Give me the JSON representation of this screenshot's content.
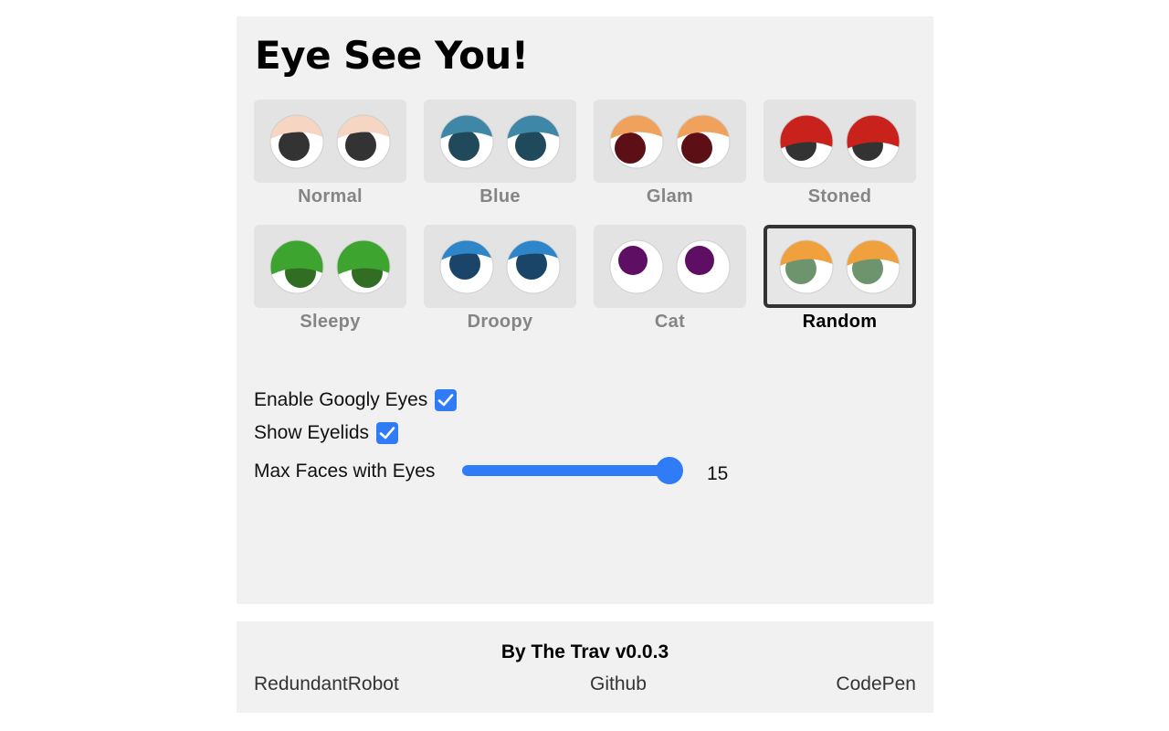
{
  "title": "Eye See You!",
  "styles": [
    {
      "label": "Normal",
      "lid": "#f6d6c2",
      "iris": "#333333",
      "style": "normal"
    },
    {
      "label": "Blue",
      "lid": "#3f87a6",
      "iris": "#21495c",
      "style": "normal"
    },
    {
      "label": "Glam",
      "lid": "#f0a25c",
      "iris": "#5c1015",
      "style": "glam"
    },
    {
      "label": "Stoned",
      "lid": "#c9221d",
      "iris": "#333333",
      "style": "stoned"
    },
    {
      "label": "Sleepy",
      "lid": "#3da52f",
      "iris": "#316e23",
      "style": "sleepy"
    },
    {
      "label": "Droopy",
      "lid": "#2e86c9",
      "iris": "#1b4568",
      "style": "droopy"
    },
    {
      "label": "Cat",
      "lid": "none",
      "iris": "#5e0f63",
      "style": "cat"
    },
    {
      "label": "Random",
      "lid": "#f0a03c",
      "iris": "#6e946e",
      "style": "random",
      "selected": true
    }
  ],
  "settings": {
    "googly_label": "Enable Googly Eyes",
    "googly_checked": true,
    "eyelids_label": "Show Eyelids",
    "eyelids_checked": true,
    "max_faces_label": "Max Faces with Eyes",
    "max_faces_value": "15",
    "max_faces_fraction": 1.0
  },
  "footer": {
    "credit": "By The Trav v0.0.3",
    "links": [
      "RedundantRobot",
      "Github",
      "CodePen"
    ]
  },
  "colors": {
    "accent": "#2f7cf6",
    "panel": "#f1f1f1",
    "tile": "#e3e3e3"
  }
}
